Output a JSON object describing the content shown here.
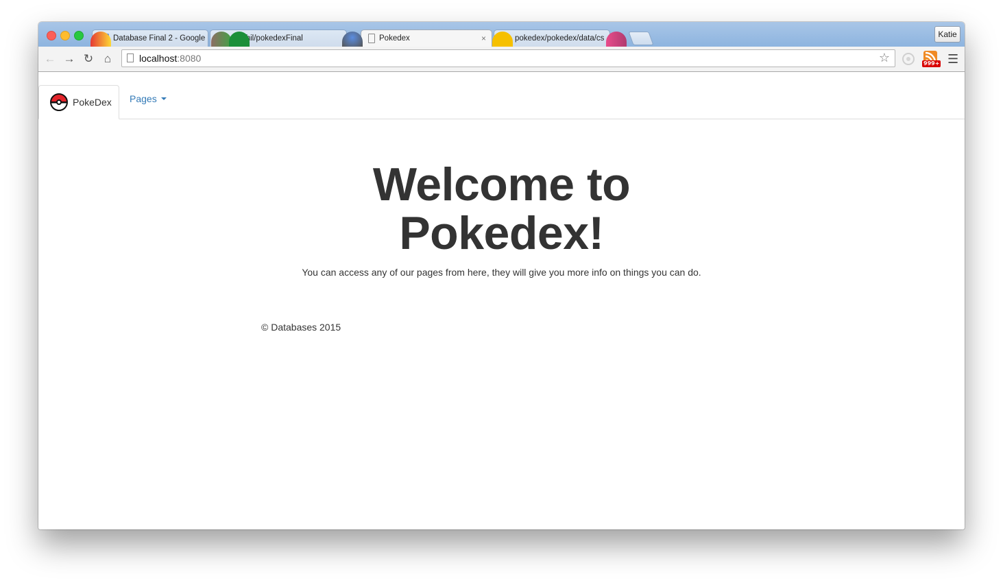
{
  "browser": {
    "tabs": [
      {
        "title": "Database Final 2 - Google",
        "active": false,
        "icon": "google-docs-icon"
      },
      {
        "title": "patchil/pokedexFinal",
        "active": false,
        "icon": "github-icon"
      },
      {
        "title": "Pokedex",
        "active": true,
        "icon": "page-icon"
      },
      {
        "title": "pokedex/pokedex/data/cs",
        "active": false,
        "icon": "github-icon"
      }
    ],
    "profile": "Katie",
    "url_host": "localhost",
    "url_port": ":8080",
    "rss_badge": "999+",
    "close_glyph": "×"
  },
  "navbar": {
    "brand": "PokeDex",
    "pages": "Pages"
  },
  "main": {
    "title_line1": "Welcome to",
    "title_line2": "Pokedex!",
    "lead": "You can access any of our pages from here, they will give you more info on things you can do."
  },
  "footer": {
    "text": "© Databases 2015"
  }
}
